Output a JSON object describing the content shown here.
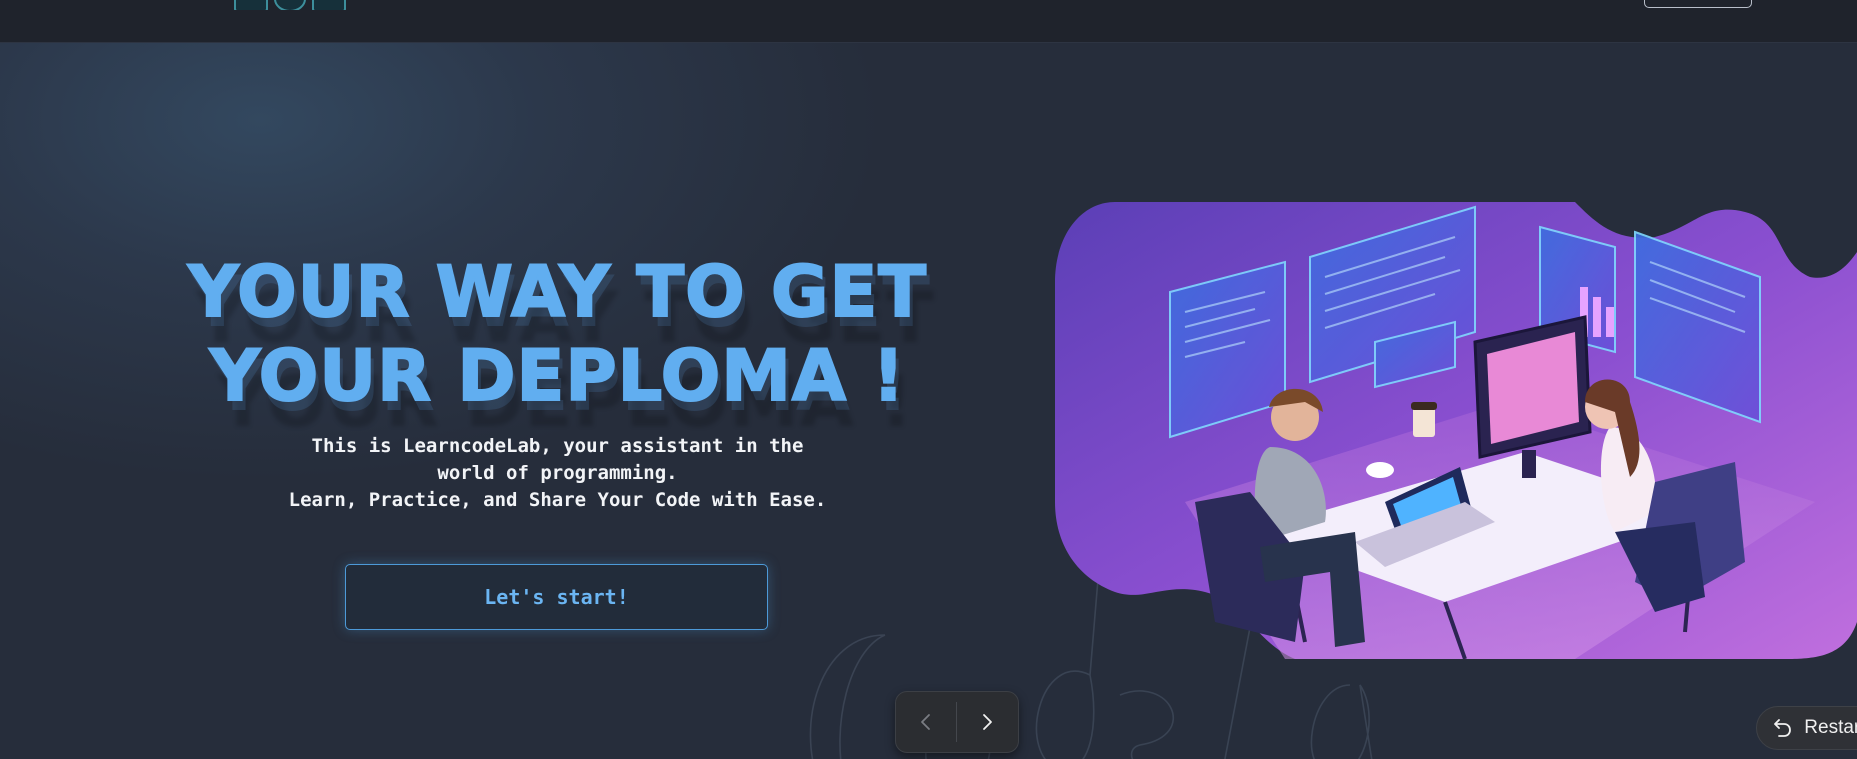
{
  "hero": {
    "title_line1": "YOUR WAY TO GET",
    "title_line2": "YOUR DEPLOMA !",
    "subtitle_line1": "This is LearncodeLab, your assistant in the",
    "subtitle_line2": "world of programming.",
    "subtitle_line3": "Learn, Practice, and Share Your Code with Ease.",
    "cta_label": "Let's start!"
  },
  "illustration": {
    "subject": "two programmers working at a desk with laptop and floating code screens",
    "icon": "programmers-illustration"
  },
  "slider": {
    "prev_icon": "chevron-left-icon",
    "next_icon": "chevron-right-icon"
  },
  "overlay": {
    "restart_label": "Restart",
    "restart_icon": "undo-icon"
  },
  "colors": {
    "accent": "#61aef0",
    "background": "#28303f",
    "topbar": "#1f232c",
    "illustration_purple": "#8a4fd0"
  }
}
